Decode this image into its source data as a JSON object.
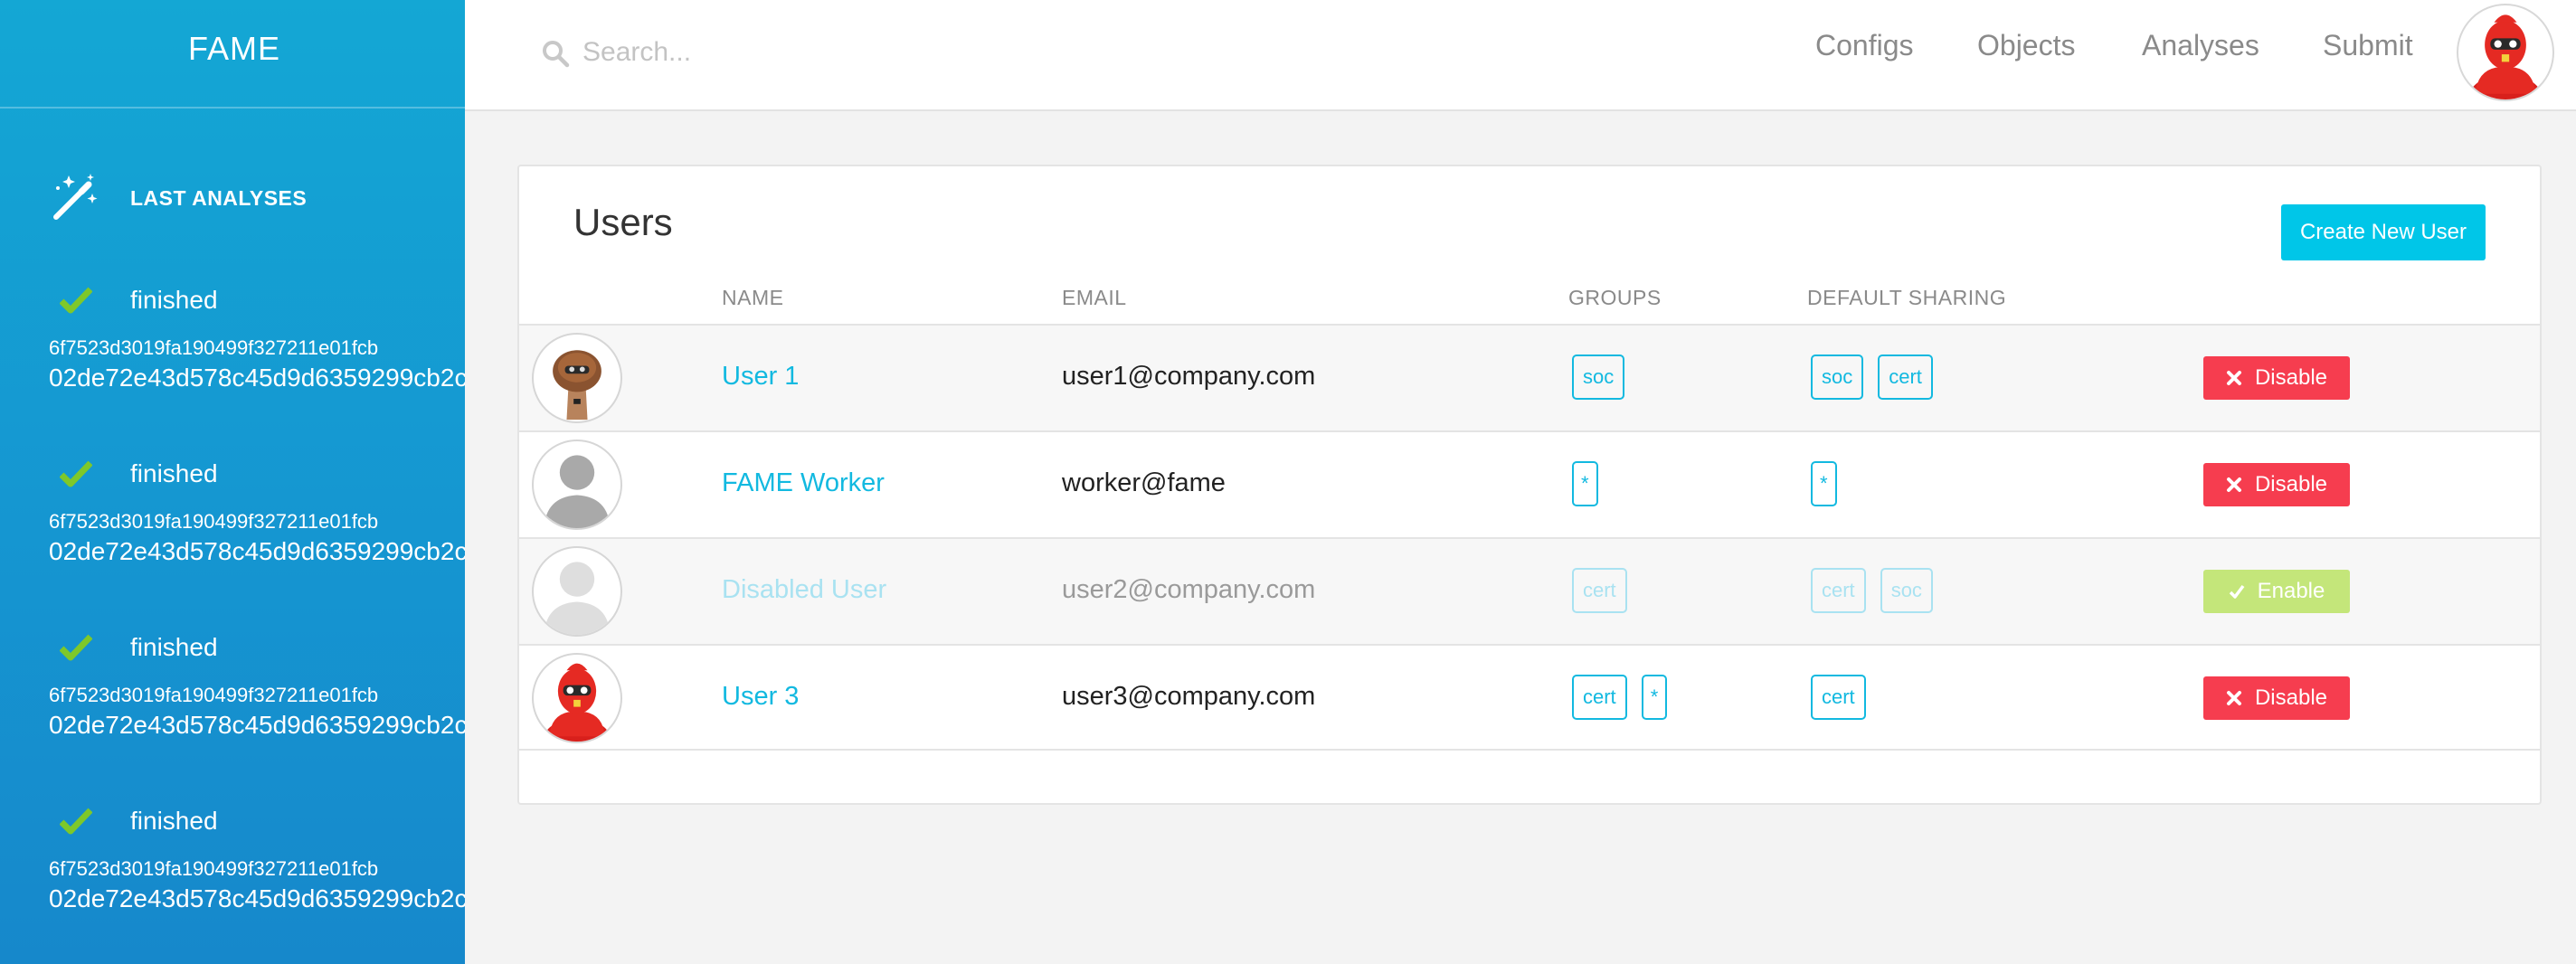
{
  "app": {
    "name": "FAME"
  },
  "search": {
    "placeholder": "Search..."
  },
  "nav": {
    "configs": "Configs",
    "objects": "Objects",
    "analyses": "Analyses",
    "submit": "Submit"
  },
  "sidebar": {
    "section_title": "LAST ANALYSES",
    "analyses": [
      {
        "status": "finished",
        "hash1": "6f7523d3019fa190499f327211e01fcb",
        "hash2": "02de72e43d578c45d9d6359299cb2c"
      },
      {
        "status": "finished",
        "hash1": "6f7523d3019fa190499f327211e01fcb",
        "hash2": "02de72e43d578c45d9d6359299cb2c"
      },
      {
        "status": "finished",
        "hash1": "6f7523d3019fa190499f327211e01fcb",
        "hash2": "02de72e43d578c45d9d6359299cb2c"
      },
      {
        "status": "finished",
        "hash1": "6f7523d3019fa190499f327211e01fcb",
        "hash2": "02de72e43d578c45d9d6359299cb2c"
      }
    ]
  },
  "users": {
    "title": "Users",
    "create_button": "Create New User",
    "columns": {
      "name": "NAME",
      "email": "EMAIL",
      "groups": "GROUPS",
      "sharing": "DEFAULT SHARING"
    },
    "rows": [
      {
        "name": "User 1",
        "email": "user1@company.com",
        "groups": [
          "soc"
        ],
        "sharing": [
          "soc",
          "cert"
        ],
        "action": "Disable",
        "enabled": true,
        "avatar": "mushroom-avatar"
      },
      {
        "name": "FAME Worker",
        "email": "worker@fame",
        "groups": [
          "*"
        ],
        "sharing": [
          "*"
        ],
        "action": "Disable",
        "enabled": true,
        "avatar": "default-avatar"
      },
      {
        "name": "Disabled User",
        "email": "user2@company.com",
        "groups": [
          "cert"
        ],
        "sharing": [
          "cert",
          "soc"
        ],
        "action": "Enable",
        "enabled": false,
        "avatar": "default-avatar"
      },
      {
        "name": "User 3",
        "email": "user3@company.com",
        "groups": [
          "cert",
          "*"
        ],
        "sharing": [
          "cert"
        ],
        "action": "Disable",
        "enabled": true,
        "avatar": "red-robot-avatar"
      }
    ]
  },
  "colors": {
    "accent": "#12b9e0",
    "create_button": "#00c6e8",
    "disable": "#f63d4f",
    "enable": "#c4e67a",
    "check": "#7ec82a",
    "sidebar": "#14a7d4"
  }
}
